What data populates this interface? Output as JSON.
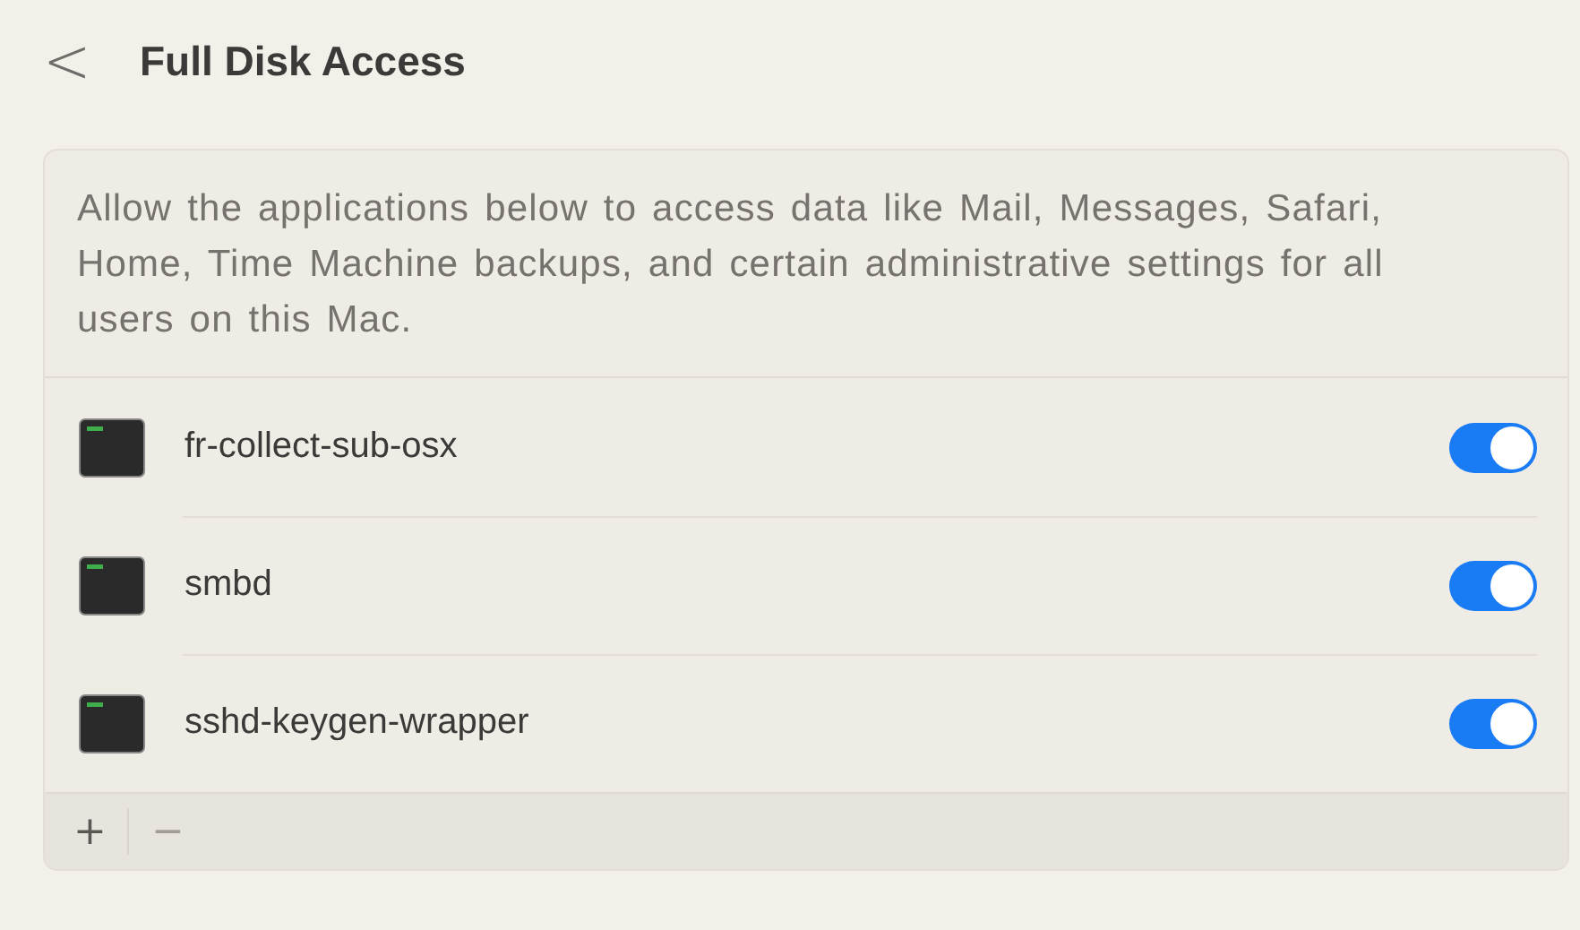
{
  "header": {
    "back": "<",
    "title": "Full Disk Access"
  },
  "description": "Allow the applications below to access data like Mail, Messages, Safari, Home, Time Machine backups, and certain administrative settings for all users on this Mac.",
  "apps": [
    {
      "name": "fr-collect-sub-osx",
      "on": true
    },
    {
      "name": "smbd",
      "on": true
    },
    {
      "name": "sshd-keygen-wrapper",
      "on": true
    }
  ],
  "footer": [
    {
      "label": "+",
      "disabled": false
    },
    {
      "label": "−",
      "disabled": true
    }
  ]
}
